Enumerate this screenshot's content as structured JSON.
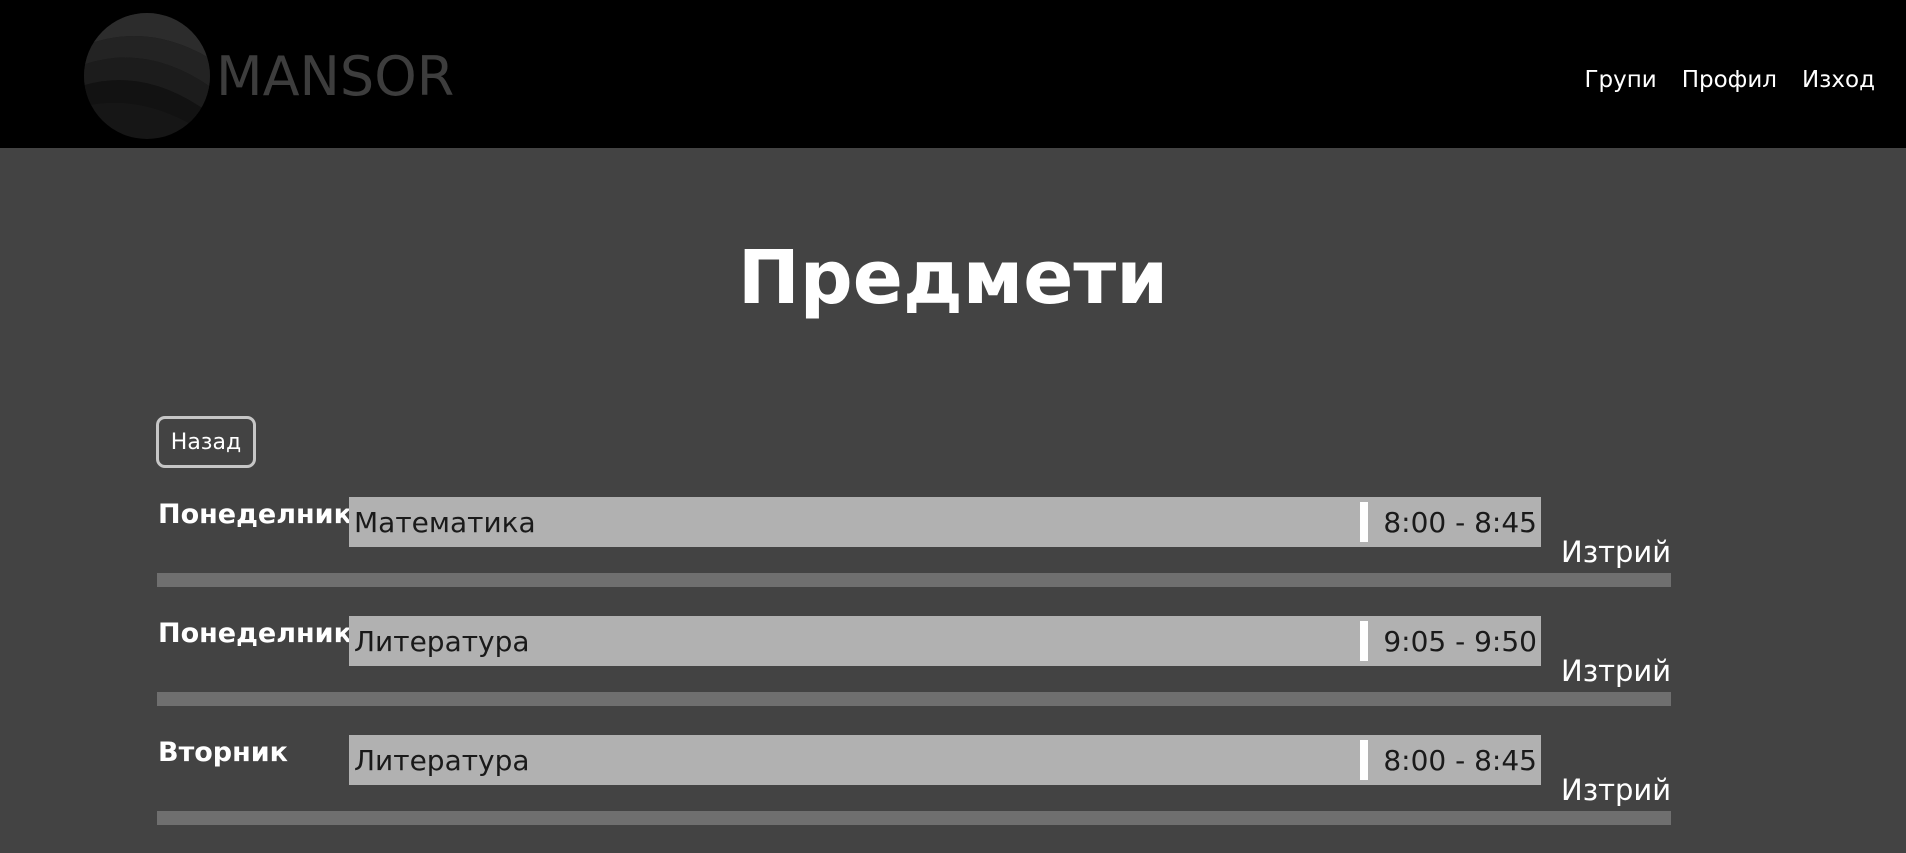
{
  "header": {
    "logo_text": "MANSOR",
    "nav": [
      {
        "label": "Групи"
      },
      {
        "label": "Профил"
      },
      {
        "label": "Изход"
      }
    ]
  },
  "main": {
    "title": "Предмети",
    "back_label": "Назад",
    "delete_label": "Изтрий",
    "subjects": [
      {
        "day": "Понеделник",
        "subject": "Математика",
        "time": "8:00 - 8:45"
      },
      {
        "day": "Понеделник",
        "subject": "Литература",
        "time": "9:05 - 9:50"
      },
      {
        "day": "Вторник",
        "subject": "Литература",
        "time": "8:00 - 8:45"
      }
    ]
  },
  "colors": {
    "header_bg": "#000000",
    "page_bg": "#434343",
    "bar_bg": "#b1b1b1",
    "divider": "#6f6f6f",
    "logo_text": "#3d3d3d"
  }
}
